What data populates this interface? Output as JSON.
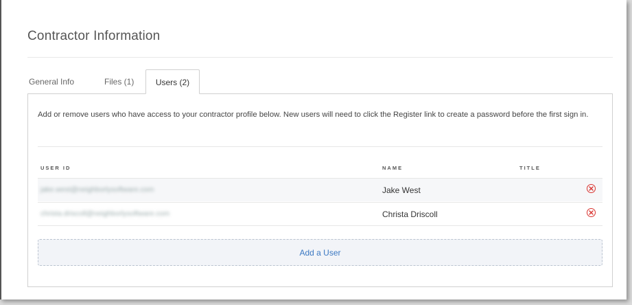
{
  "page": {
    "title": "Contractor Information"
  },
  "tabs": [
    {
      "label": "General Info",
      "active": false
    },
    {
      "label": "Files (1)",
      "active": false
    },
    {
      "label": "Users (2)",
      "active": true
    }
  ],
  "users_panel": {
    "description": "Add or remove users who have access to your contractor profile below.  New users will need to click the Register link to create a password before the first sign in.",
    "columns": {
      "user_id": "USER ID",
      "name": "NAME",
      "title": "TITLE"
    },
    "rows": [
      {
        "user_id": "jake.west@neighborlysoftware.com",
        "name": "Jake West",
        "title": ""
      },
      {
        "user_id": "christa.driscoll@neighborlysoftware.com",
        "name": "Christa Driscoll",
        "title": ""
      }
    ],
    "add_user_label": "Add a User"
  },
  "colors": {
    "accent": "#3b78c2",
    "danger": "#d9322e"
  },
  "icons": {
    "remove": "remove-circle-x-icon"
  }
}
